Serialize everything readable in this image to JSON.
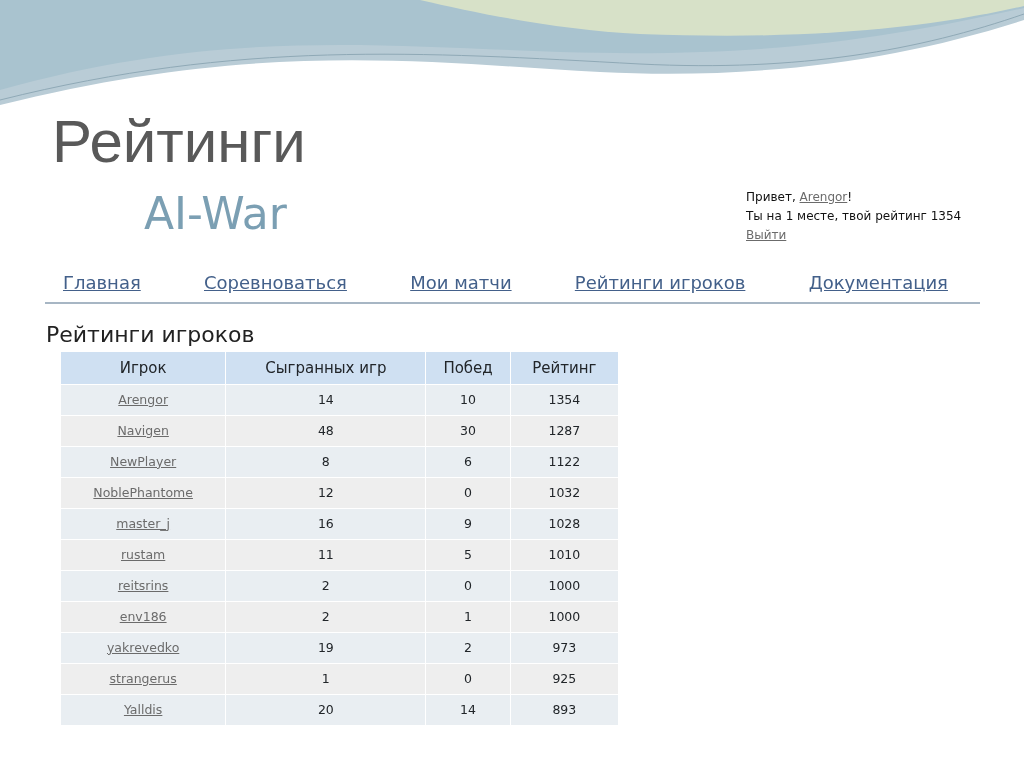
{
  "slide_title": "Рейтинги",
  "site": {
    "title": "AI-War"
  },
  "user_panel": {
    "greeting_prefix": "Привет, ",
    "user": "Arengor",
    "greeting_suffix": "!",
    "rank_text": "Ты на 1 месте, твой рейтинг 1354",
    "logout": "Выйти"
  },
  "nav": [
    "Главная",
    "Соревноваться",
    "Мои матчи",
    "Рейтинги игроков",
    "Документация"
  ],
  "heading": "Рейтинги игроков",
  "table": {
    "columns": [
      "Игрок",
      "Сыгранных игр",
      "Побед",
      "Рейтинг"
    ],
    "rows": [
      [
        "Arengor",
        "14",
        "10",
        "1354"
      ],
      [
        "Navigen",
        "48",
        "30",
        "1287"
      ],
      [
        "NewPlayer",
        "8",
        "6",
        "1122"
      ],
      [
        "NoblePhantome",
        "12",
        "0",
        "1032"
      ],
      [
        "master_j",
        "16",
        "9",
        "1028"
      ],
      [
        "rustam",
        "11",
        "5",
        "1010"
      ],
      [
        "reitsrins",
        "2",
        "0",
        "1000"
      ],
      [
        "env186",
        "2",
        "1",
        "1000"
      ],
      [
        "yakrevedko",
        "19",
        "2",
        "973"
      ],
      [
        "strangerus",
        "1",
        "0",
        "925"
      ],
      [
        "Yalldis",
        "20",
        "14",
        "893"
      ]
    ]
  }
}
